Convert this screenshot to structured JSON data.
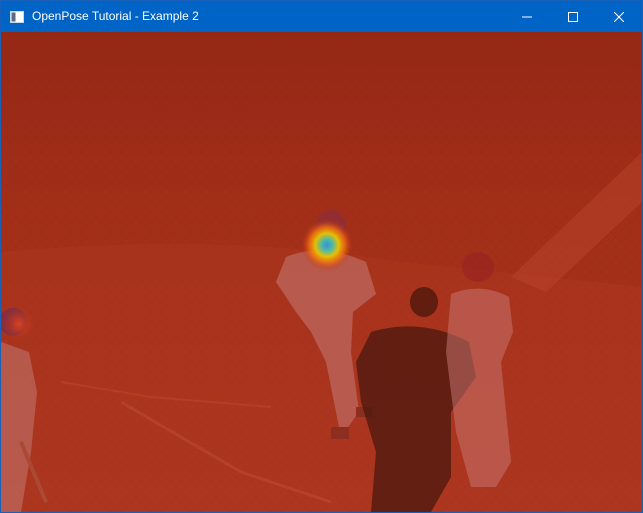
{
  "window": {
    "title": "OpenPose Tutorial - Example 2",
    "controls": [
      "minimize",
      "maximize",
      "close"
    ]
  },
  "icons": {
    "app": "window-app-icon",
    "minimize": "minimize-icon",
    "maximize": "maximize-icon",
    "close": "close-icon"
  },
  "colors": {
    "titlebar": "#0063c6",
    "overlay_base": "#b0301a",
    "heatmap_hot": "#f0e000",
    "heatmap_core": "#1aa9ff"
  },
  "content": {
    "description_type": "image",
    "overlay": "heatmap"
  }
}
